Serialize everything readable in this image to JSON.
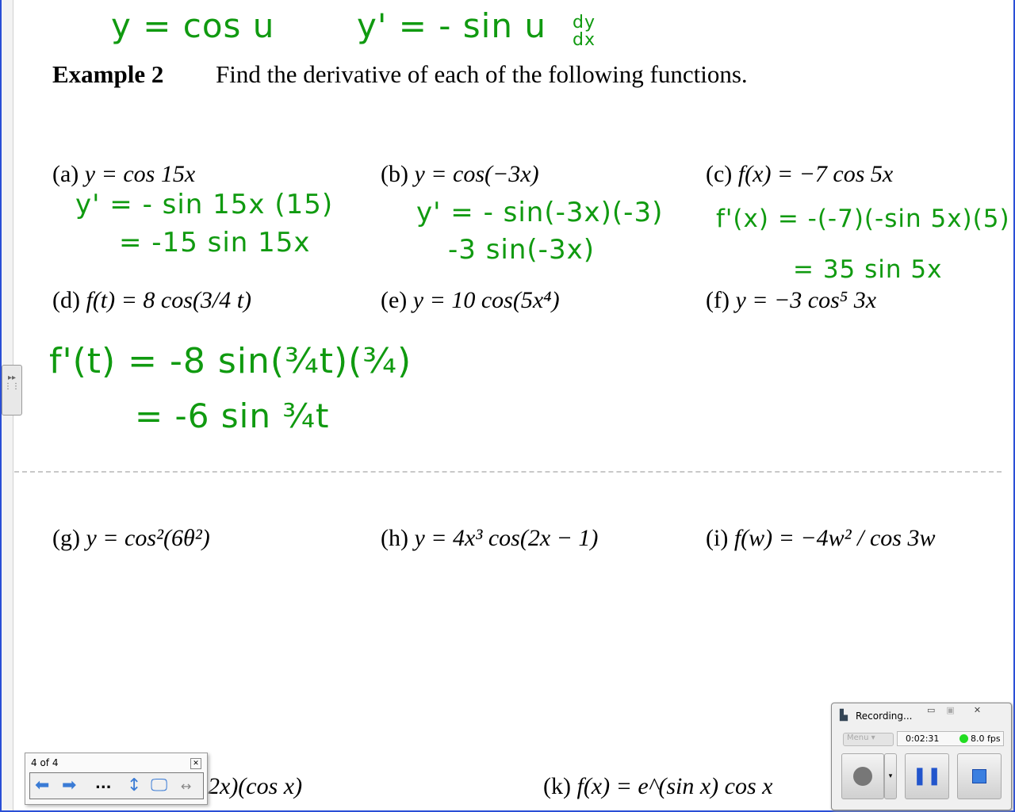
{
  "handwriting": {
    "top_left": "y = cos u",
    "top_right": "y' = - sin u",
    "top_right_frac_num": "dy",
    "top_right_frac_den": "dx",
    "a1": "y' = - sin 15x (15)",
    "a2": "= -15 sin 15x",
    "b1": "y' = - sin(-3x)(-3)",
    "b2": "-3 sin(-3x)",
    "c1": "f'(x) = -(-7)(-sin 5x)(5)",
    "c2": "= 35 sin 5x",
    "d1": "f'(t) = -8 sin(¾t)(¾)",
    "d2": "= -6 sin ¾t"
  },
  "document": {
    "example_label": "Example 2",
    "example_text": "Find the derivative of each of the following functions.",
    "problems": [
      {
        "label": "(a)",
        "expr": "y = cos 15x"
      },
      {
        "label": "(b)",
        "expr": "y = cos(−3x)"
      },
      {
        "label": "(c)",
        "expr": "f(x) = −7 cos 5x"
      },
      {
        "label": "(d)",
        "expr": "f(t) = 8 cos(3/4 t)"
      },
      {
        "label": "(e)",
        "expr": "y = 10 cos(5x⁴)"
      },
      {
        "label": "(f)",
        "expr": "y = −3 cos⁵ 3x"
      },
      {
        "label": "(g)",
        "expr": "y = cos²(6θ²)"
      },
      {
        "label": "(h)",
        "expr": "y = 4x³ cos(2x − 1)"
      },
      {
        "label": "(i)",
        "expr": "f(w) = −4w² / cos 3w"
      },
      {
        "label": "",
        "expr": "2x)(cos x)"
      },
      {
        "label": "(k)",
        "expr": "f(x) = e^(sin x) cos x"
      }
    ]
  },
  "pager": {
    "label": "4 of 4",
    "more": "..."
  },
  "recorder": {
    "title": "Recording...",
    "menu": "Menu",
    "time": "0:02:31",
    "fps": "8.0 fps",
    "status_color": "#22dd22"
  }
}
